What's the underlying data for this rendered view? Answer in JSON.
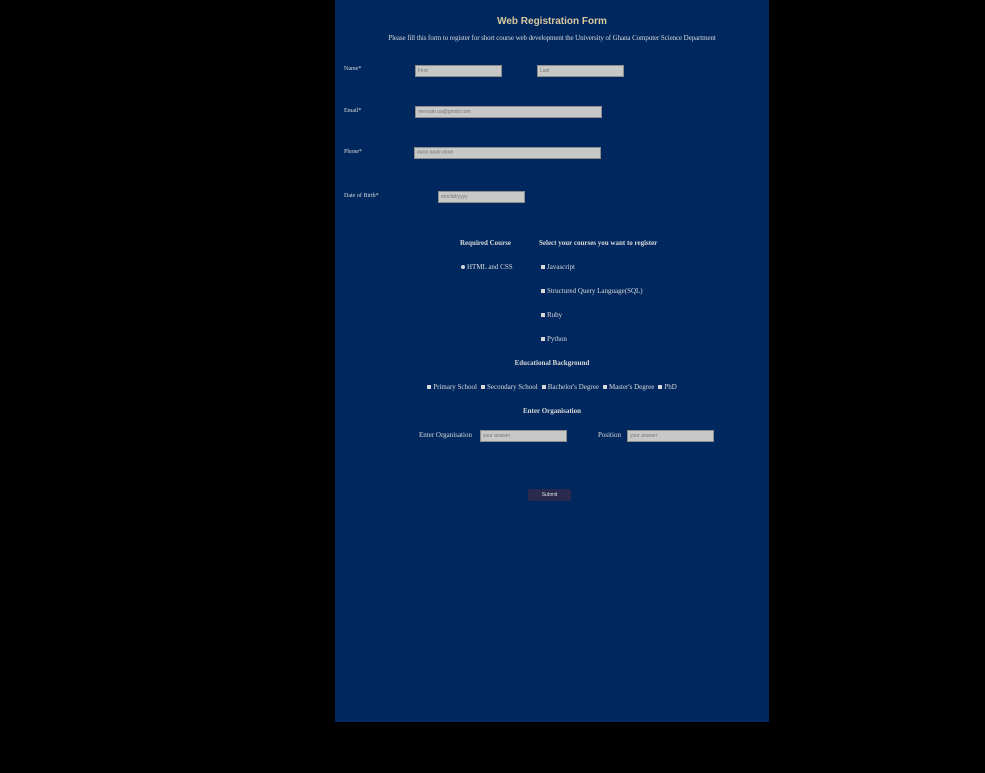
{
  "form": {
    "title": "Web Registration Form",
    "subtitle": "Please fill this form to register for short course web development the University of Ghana Computer Science Department",
    "name_label": "Name*",
    "first_placeholder": "First",
    "last_placeholder": "Last",
    "email_label": "Email*",
    "email_placeholder": "mensah.ua@gmail.com",
    "phone_label": "Phone*",
    "phone_placeholder": "#### #### ####",
    "dob_label": "Date of Birth*",
    "dob_placeholder": "mm/dd/yyyy"
  },
  "courses": {
    "required_heading": "Required Course",
    "required_item": "HTML and CSS",
    "optional_heading": "Select your courses you want to register",
    "optional_items": [
      "Javascript",
      "Structured Query Language(SQL)",
      "Ruby",
      "Python"
    ]
  },
  "education": {
    "heading": "Educational Background",
    "items": [
      "Primary School",
      "Secondary School",
      "Bachelor's Degree",
      "Master's Degree",
      "PhD"
    ]
  },
  "organisation": {
    "heading": "Enter Organisation",
    "org_label": "Enter Organisation",
    "org_placeholder": "your answer",
    "position_label": "Position",
    "position_placeholder": "your answer"
  },
  "submit_label": "Submit",
  "colors": {
    "background": "#000000",
    "panel": "#00285f",
    "title": "#d8c9a0",
    "submit": "#2a2a4e"
  }
}
